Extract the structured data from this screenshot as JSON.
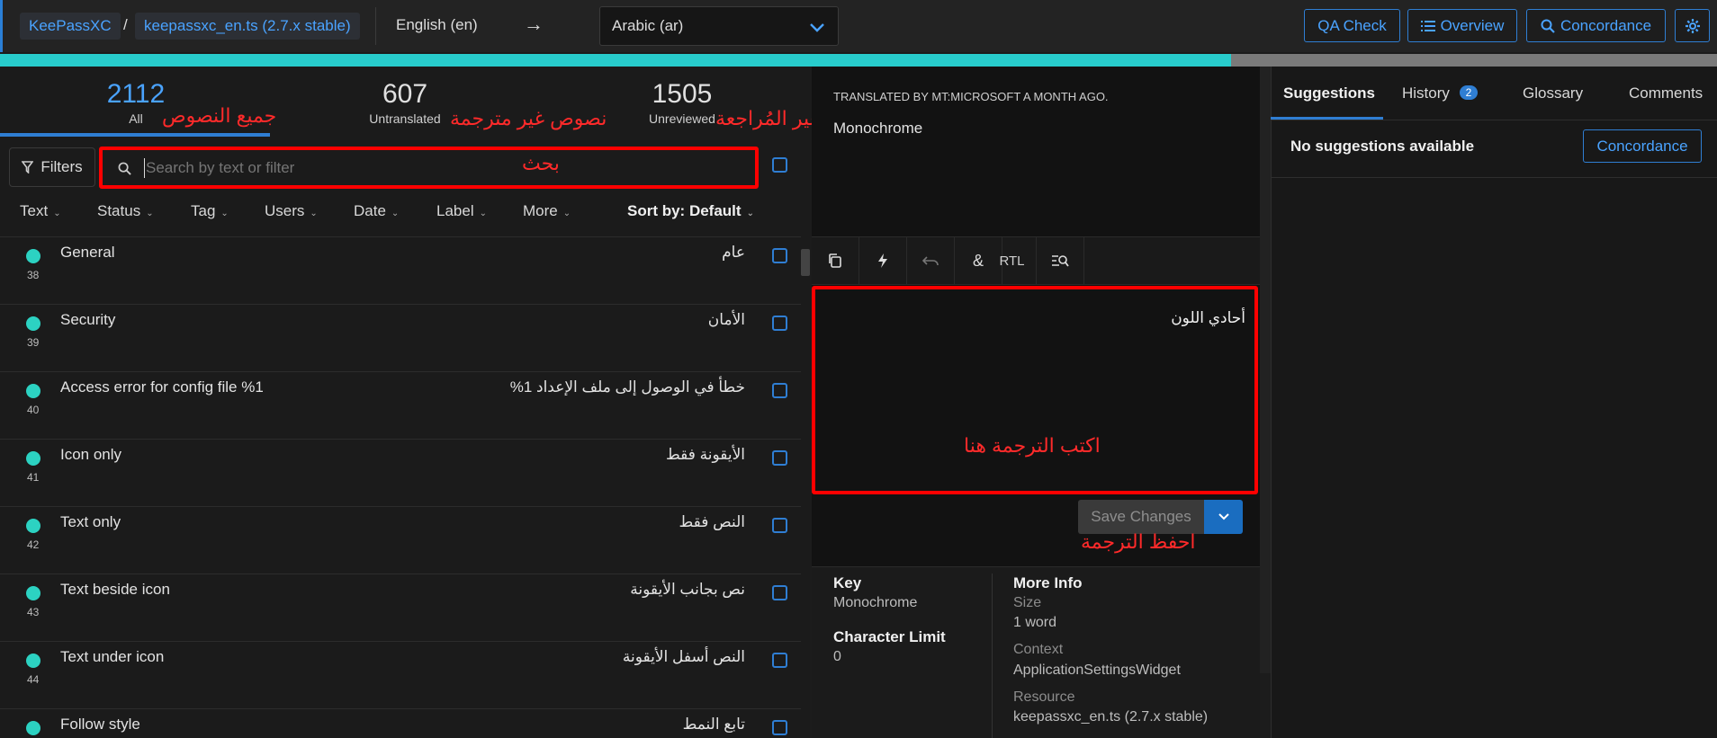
{
  "topbar": {
    "project": "KeePassXC",
    "separator": "/",
    "resource": "keepassxc_en.ts (2.7.x stable)",
    "source_lang": "English (en)",
    "arrow": "→",
    "target_lang": "Arabic (ar)",
    "qa_check": "QA Check",
    "overview": "Overview",
    "concordance": "Concordance"
  },
  "progress": {
    "fill_fraction": 0.717
  },
  "stats": {
    "all": {
      "count": "2112",
      "label": "All"
    },
    "untranslated": {
      "count": "607",
      "label": "Untranslated"
    },
    "unreviewed": {
      "count": "1505",
      "label": "Unreviewed"
    }
  },
  "annotations": {
    "all_texts": "جميع النصوص",
    "untranslated_texts": "نصوص غير مترجمة",
    "unreviewed": "غير المُراجعة",
    "search": "بحث",
    "write_here": "اكتب الترجمة هنا",
    "save_translation": "احفظ الترجمة"
  },
  "filters": {
    "button": "Filters",
    "search_placeholder": "Search by text or filter",
    "tabs": [
      "Text",
      "Status",
      "Tag",
      "Users",
      "Date",
      "Label",
      "More"
    ],
    "sort": "Sort by: Default"
  },
  "strings": [
    {
      "source": "General",
      "translation": "عام",
      "num": "38"
    },
    {
      "source": "Security",
      "translation": "الأمان",
      "num": "39"
    },
    {
      "source": "Access error for config file %1",
      "translation": "خطأ في الوصول إلى ملف الإعداد 1%",
      "num": "40"
    },
    {
      "source": "Icon only",
      "translation": "الأيقونة فقط",
      "num": "41"
    },
    {
      "source": "Text only",
      "translation": "النص فقط",
      "num": "42"
    },
    {
      "source": "Text beside icon",
      "translation": "نص بجانب الأيقونة",
      "num": "43"
    },
    {
      "source": "Text under icon",
      "translation": "النص أسفل الأيقونة",
      "num": "44"
    },
    {
      "source": "Follow style",
      "translation": "تابع النمط",
      "num": ""
    }
  ],
  "editor": {
    "translated_by": "TRANSLATED BY MT:MICROSOFT A MONTH AGO.",
    "source_text": "Monochrome",
    "rtl_label": "RTL",
    "translation_value": "أحادي اللون",
    "save_button": "Save Changes"
  },
  "info": {
    "key_label": "Key",
    "key_value": "Monochrome",
    "char_limit_label": "Character Limit",
    "char_limit_value": "0",
    "more_info_label": "More Info",
    "size_label": "Size",
    "size_value": "1 word",
    "context_label": "Context",
    "context_value": "ApplicationSettingsWidget",
    "resource_label": "Resource",
    "resource_value": "keepassxc_en.ts (2.7.x stable)"
  },
  "right": {
    "tabs": {
      "suggestions": "Suggestions",
      "history": "History",
      "history_badge": "2",
      "glossary": "Glossary",
      "comments": "Comments"
    },
    "no_suggestions": "No suggestions available",
    "concordance_button": "Concordance"
  },
  "colors": {
    "accent": "#2f7ed3",
    "progress": "#28cccc",
    "status_dot": "#2cd2c2",
    "annotation": "#ff0000"
  }
}
